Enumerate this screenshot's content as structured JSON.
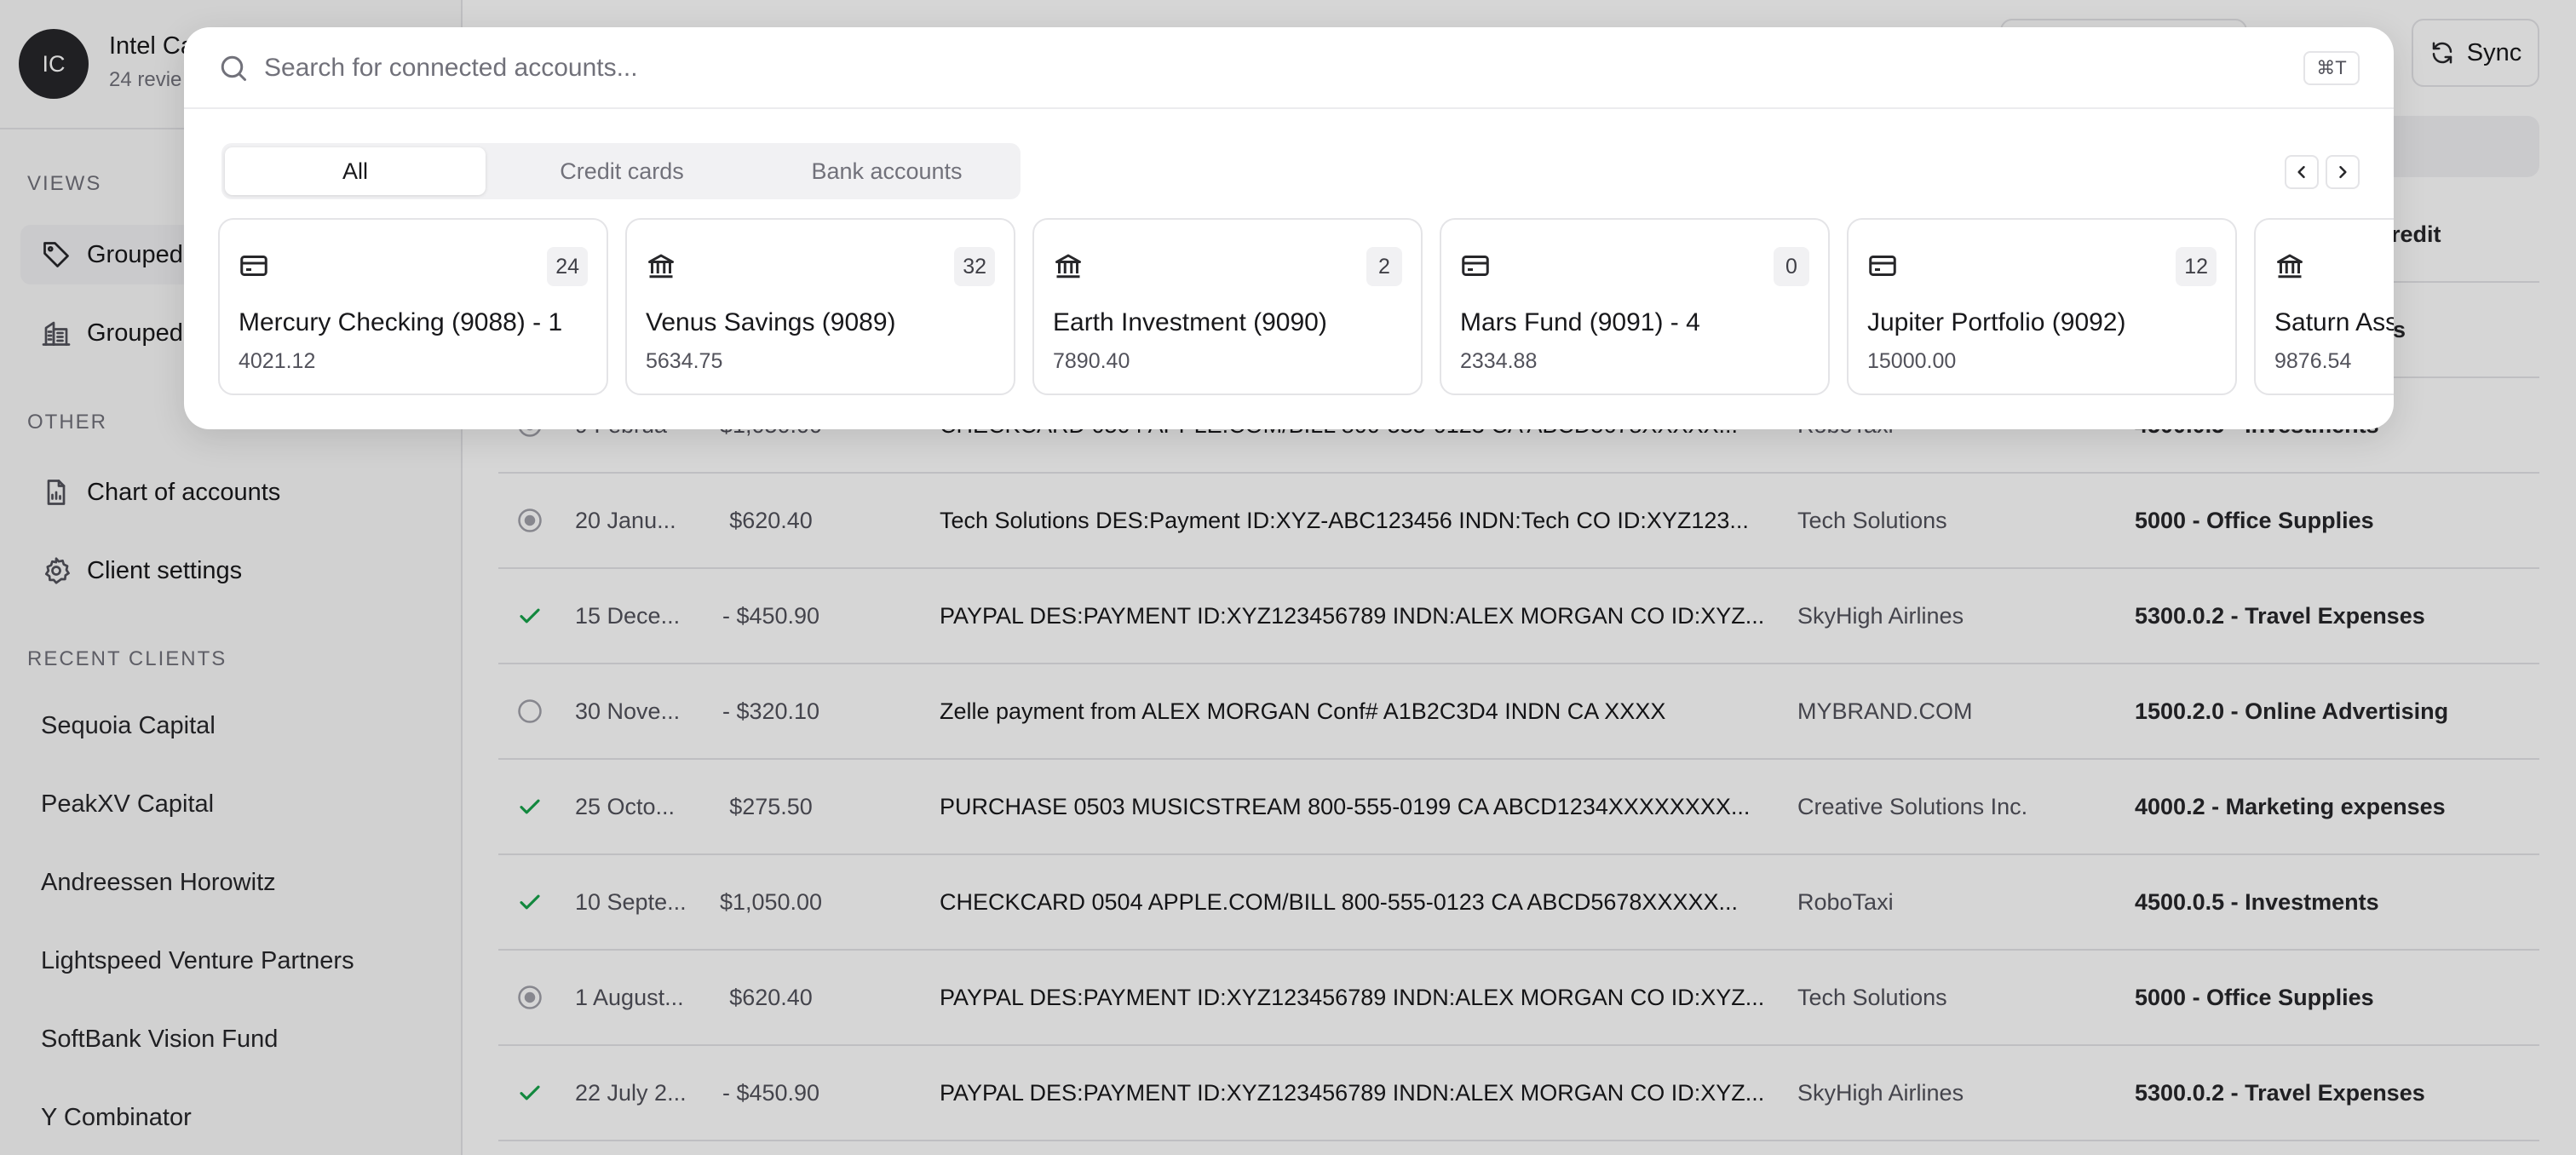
{
  "sidebar": {
    "client": {
      "initials": "IC",
      "name": "Intel Ca",
      "sub": "24 revie"
    },
    "views_title": "VIEWS",
    "views": [
      {
        "label": "Grouped",
        "icon": "tag-icon"
      },
      {
        "label": "Grouped",
        "icon": "building-icon"
      }
    ],
    "other_title": "OTHER",
    "other": [
      {
        "label": "Chart of accounts",
        "icon": "chart-icon"
      },
      {
        "label": "Client settings",
        "icon": "gear-icon"
      }
    ],
    "recent_title": "RECENT CLIENTS",
    "recent": [
      "Sequoia Capital",
      "PeakXV Capital",
      "Andreessen Horowitz",
      "Lightspeed Venture Partners",
      "SoftBank Vision Fund",
      "Y Combinator"
    ]
  },
  "toolbar": {
    "sync_label": "Sync"
  },
  "table": {
    "header_category": "t Credit",
    "row0_category": "s",
    "partial_row": {
      "date": "9 Februa",
      "amount": "$1,050.00",
      "description": "CHECKCARD 0504 APPLE.COM/BILL 800-555-0123 CA ABCD5678XXXXX...",
      "vendor": "RoboTaxi",
      "category": "4500.0.5 - Investments"
    },
    "rows": [
      {
        "status": "radio-checked",
        "date": "20 Janu...",
        "amount": "$620.40",
        "description": "Tech Solutions DES:Payment ID:XYZ-ABC123456 INDN:Tech CO ID:XYZ123...",
        "vendor": "Tech Solutions",
        "category": "5000 - Office Supplies"
      },
      {
        "status": "check",
        "date": "15 Dece...",
        "amount": "- $450.90",
        "description": "PAYPAL DES:PAYMENT ID:XYZ123456789 INDN:ALEX MORGAN CO ID:XYZ...",
        "vendor": "SkyHigh Airlines",
        "category": "5300.0.2 - Travel Expenses"
      },
      {
        "status": "radio-empty",
        "date": "30 Nove...",
        "amount": "- $320.10",
        "description": "Zelle payment from ALEX MORGAN Conf# A1B2C3D4 INDN CA XXXX",
        "vendor": "MYBRAND.COM",
        "category": "1500.2.0 - Online Advertising"
      },
      {
        "status": "check",
        "date": "25 Octo...",
        "amount": "$275.50",
        "description": "PURCHASE 0503 MUSICSTREAM 800-555-0199 CA ABCD1234XXXXXXXX...",
        "vendor": "Creative Solutions Inc.",
        "category": "4000.2 - Marketing expenses"
      },
      {
        "status": "check",
        "date": "10 Septe...",
        "amount": "$1,050.00",
        "description": "CHECKCARD 0504 APPLE.COM/BILL 800-555-0123 CA ABCD5678XXXXX...",
        "vendor": "RoboTaxi",
        "category": "4500.0.5 - Investments"
      },
      {
        "status": "radio-checked",
        "date": "1 August...",
        "amount": "$620.40",
        "description": "PAYPAL DES:PAYMENT ID:XYZ123456789 INDN:ALEX MORGAN CO ID:XYZ...",
        "vendor": "Tech Solutions",
        "category": "5000 - Office Supplies"
      },
      {
        "status": "check",
        "date": "22 July 2...",
        "amount": "- $450.90",
        "description": "PAYPAL DES:PAYMENT ID:XYZ123456789 INDN:ALEX MORGAN CO ID:XYZ...",
        "vendor": "SkyHigh Airlines",
        "category": "5300.0.2 - Travel Expenses"
      }
    ]
  },
  "modal": {
    "search_placeholder": "Search for connected accounts...",
    "search_value": "",
    "shortcut": "⌘T",
    "tabs": [
      "All",
      "Credit cards",
      "Bank accounts"
    ],
    "active_tab": "All",
    "accounts": [
      {
        "name": "Mercury Checking (9088) - 1",
        "balance": "4021.12",
        "count": "24",
        "icon": "credit-card-icon"
      },
      {
        "name": "Venus Savings (9089)",
        "balance": "5634.75",
        "count": "32",
        "icon": "bank-icon"
      },
      {
        "name": "Earth Investment (9090)",
        "balance": "7890.40",
        "count": "2",
        "icon": "bank-icon"
      },
      {
        "name": "Mars Fund (9091) - 4",
        "balance": "2334.88",
        "count": "0",
        "icon": "credit-card-icon"
      },
      {
        "name": "Jupiter Portfolio (9092)",
        "balance": "15000.00",
        "count": "12",
        "icon": "credit-card-icon"
      },
      {
        "name": "Saturn Ass",
        "balance": "9876.54",
        "count": "",
        "icon": "bank-icon"
      }
    ]
  },
  "colors": {
    "check": "#16a34a",
    "muted": "#71717a",
    "border": "#e4e4e7"
  }
}
